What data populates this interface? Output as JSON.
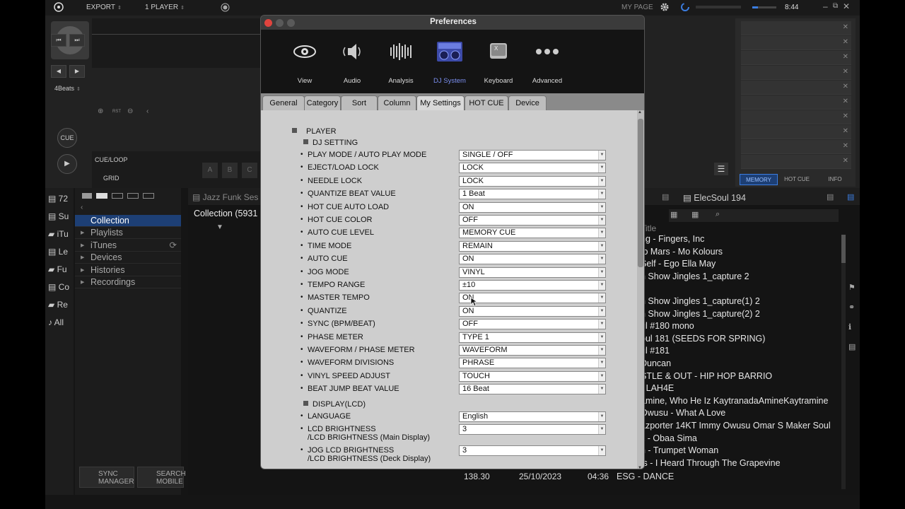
{
  "topbar": {
    "export_label": "EXPORT",
    "player_label": "1 PLAYER",
    "mypage_label": "MY PAGE",
    "time": "8:44"
  },
  "deck": {
    "beats_label": "4Beats",
    "cue_label": "CUE",
    "cueloop_label": "CUE/LOOP",
    "grid_label": "GRID",
    "rst_label": "RST",
    "pads": [
      "A",
      "B",
      "C"
    ],
    "right_tabs": [
      "MEMORY",
      "HOT CUE",
      "INFO"
    ]
  },
  "browser": {
    "left_items": [
      "72",
      "Su",
      "iTu",
      "Le",
      "Fu",
      "Co",
      "Re",
      "All"
    ],
    "tree": [
      "Collection",
      "Playlists",
      "iTunes",
      "Devices",
      "Histories",
      "Recordings"
    ],
    "list_tab_left": "Jazz Funk Ses",
    "collection_label": "Collection (5931",
    "list_tab_right": "ElecSoul 194",
    "title_header": "Title",
    "titles": [
      "ng - Fingers, Inc",
      "to Mars - Mo Kolours",
      "Self - Ego Ella May",
      "n Show Jingles 1_capture 2",
      "",
      "n Show Jingles 1_capture(1) 2",
      "n Show Jingles 1_capture(2) 2",
      "ul #180 mono",
      "oul 181 (SEEDS FOR SPRING)",
      "ul #181",
      "Duncan",
      "STLE & OUT - HIP HOP BARRIO",
      "- LAH4E",
      "amine, Who He Iz KaytranadaAmineKaytramine",
      "Owusu - What A Love",
      "azporter 14KT Immy Owusu Omar S Maker Soul",
      "k - Obaa Sima",
      "n - Trumpet Woman",
      "ts - I Heard Through The Grapevine"
    ],
    "bottom_row": {
      "bpm": "138.30",
      "date": "25/10/2023",
      "time": "04:36",
      "title": "ESG - DANCE"
    },
    "sync_manager": "SYNC\nMANAGER",
    "search_mobile": "SEARCH\nMOBILE"
  },
  "prefs": {
    "title": "Preferences",
    "toolbar": [
      {
        "label": "View",
        "icon": "eye-icon"
      },
      {
        "label": "Audio",
        "icon": "speaker-icon"
      },
      {
        "label": "Analysis",
        "icon": "waveform-icon"
      },
      {
        "label": "DJ System",
        "icon": "dj-system-icon",
        "active": true
      },
      {
        "label": "Keyboard",
        "icon": "keyboard-icon"
      },
      {
        "label": "Advanced",
        "icon": "more-icon"
      }
    ],
    "tabs": [
      "General",
      "Category",
      "Sort",
      "Column",
      "My Settings",
      "HOT CUE",
      "Device"
    ],
    "active_tab": "My Settings",
    "player_header": "PLAYER",
    "dj_setting_header": "DJ SETTING",
    "settings": [
      {
        "label": "PLAY MODE / AUTO PLAY MODE",
        "value": "SINGLE / OFF"
      },
      {
        "label": "EJECT/LOAD LOCK",
        "value": "LOCK"
      },
      {
        "label": "NEEDLE LOCK",
        "value": "LOCK"
      },
      {
        "label": "QUANTIZE BEAT VALUE",
        "value": "1 Beat"
      },
      {
        "label": "HOT CUE AUTO LOAD",
        "value": "ON"
      },
      {
        "label": "HOT CUE COLOR",
        "value": "OFF"
      },
      {
        "label": "AUTO CUE LEVEL",
        "value": "MEMORY CUE"
      },
      {
        "label": "TIME MODE",
        "value": "REMAIN"
      },
      {
        "label": "AUTO CUE",
        "value": "ON"
      },
      {
        "label": "JOG MODE",
        "value": "VINYL"
      },
      {
        "label": "TEMPO RANGE",
        "value": "±10"
      },
      {
        "label": "MASTER TEMPO",
        "value": "ON"
      },
      {
        "label": "QUANTIZE",
        "value": "ON"
      },
      {
        "label": "SYNC (BPM/BEAT)",
        "value": "OFF"
      },
      {
        "label": "PHASE METER",
        "value": "TYPE 1"
      },
      {
        "label": "WAVEFORM / PHASE METER",
        "value": "WAVEFORM"
      },
      {
        "label": "WAVEFORM DIVISIONS",
        "value": "PHRASE"
      },
      {
        "label": "VINYL SPEED ADJUST",
        "value": "TOUCH"
      },
      {
        "label": "BEAT JUMP BEAT VALUE",
        "value": "16 Beat"
      }
    ],
    "display_header": "DISPLAY(LCD)",
    "display_settings": [
      {
        "label": "LANGUAGE",
        "label2": "",
        "value": "English"
      },
      {
        "label": "LCD BRIGHTNESS",
        "label2": "/LCD BRIGHTNESS (Main Display)",
        "value": "3"
      },
      {
        "label": "JOG LCD BRIGHTNESS",
        "label2": "/LCD BRIGHTNESS (Deck Display)",
        "value": "3"
      }
    ]
  }
}
